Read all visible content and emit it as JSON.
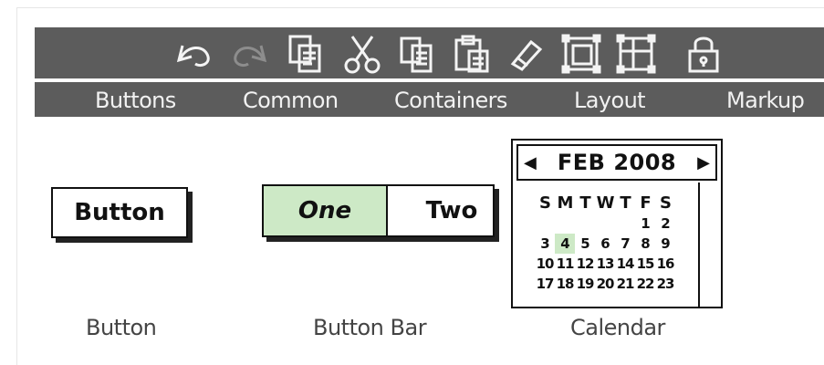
{
  "toolbar": {
    "tools": [
      {
        "name": "undo-icon"
      },
      {
        "name": "redo-icon"
      },
      {
        "name": "duplicate-icon"
      },
      {
        "name": "cut-icon"
      },
      {
        "name": "copy-icon"
      },
      {
        "name": "paste-icon"
      },
      {
        "name": "eraser-icon"
      },
      {
        "name": "group-icon"
      },
      {
        "name": "ungroup-icon"
      },
      {
        "name": "lock-icon"
      }
    ]
  },
  "tabs": [
    "Buttons",
    "Common",
    "Containers",
    "Layout",
    "Markup"
  ],
  "widgets": {
    "button": {
      "label": "Button",
      "caption": "Button"
    },
    "button_bar": {
      "segments": [
        "One",
        "Two"
      ],
      "caption": "Button Bar"
    },
    "calendar": {
      "month": "FEB 2008",
      "prev": "◀",
      "next": "▶",
      "weekdays": [
        "S",
        "M",
        "T",
        "W",
        "T",
        "F",
        "S"
      ],
      "rows": [
        [
          "",
          "",
          "",
          "",
          "",
          "1",
          "2"
        ],
        [
          "3",
          "4",
          "5",
          "6",
          "7",
          "8",
          "9"
        ],
        [
          "10",
          "11",
          "12",
          "13",
          "14",
          "15",
          "16"
        ],
        [
          "17",
          "18",
          "19",
          "20",
          "21",
          "22",
          "23"
        ]
      ],
      "highlighted_day": "4",
      "caption": "Calendar"
    }
  }
}
